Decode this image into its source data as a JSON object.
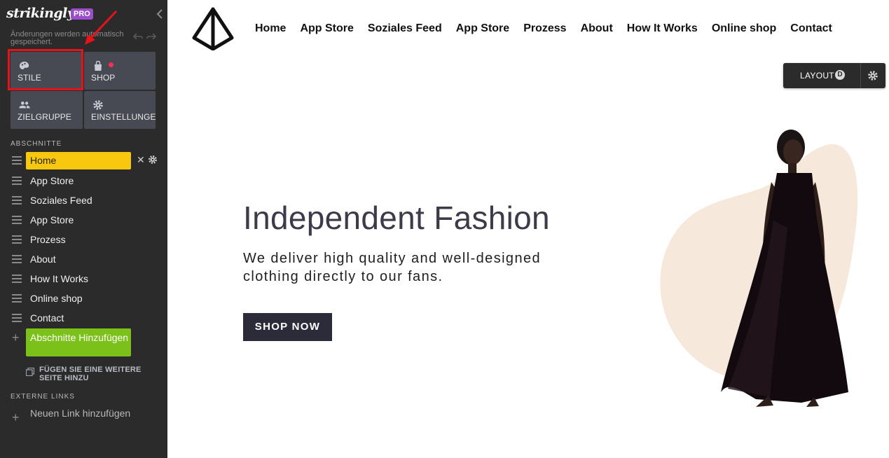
{
  "sidebar": {
    "logo": "strikingly",
    "badge": "PRO",
    "save_note": "Änderungen werden automatisch gespeichert.",
    "tiles": {
      "stile": "STILE",
      "shop": "SHOP",
      "zielgruppe": "ZIELGRUPPE",
      "einstellungen": "EINSTELLUNGEN"
    },
    "sections_heading": "ABSCHNITTE",
    "sections": [
      "Home",
      "App Store",
      "Soziales Feed",
      "App Store",
      "Prozess",
      "About",
      "How It Works",
      "Online shop",
      "Contact"
    ],
    "add_section": "Abschnitte Hinzufügen",
    "add_page": "FÜGEN SIE EINE WEITERE SEITE HINZU",
    "external_heading": "EXTERNE LINKS",
    "add_link": "Neuen Link hinzufügen"
  },
  "nav": {
    "items": [
      "Home",
      "App Store",
      "Soziales Feed",
      "App Store",
      "Prozess",
      "About",
      "How It Works",
      "Online shop",
      "Contact"
    ]
  },
  "layout_button": {
    "label": "LAYOUT",
    "badge": "D"
  },
  "hero": {
    "title": "Independent Fashion",
    "subtitle": "We deliver high quality and well-designed clothing directly to our fans.",
    "cta": "SHOP NOW"
  },
  "colors": {
    "sidebar_bg": "#2b2b2b",
    "tile_bg": "#474a53",
    "active_section": "#f8c80f",
    "add_button": "#7bc11a",
    "pro_badge": "#9b4dca",
    "highlight": "#e8121a",
    "cta_bg": "#2c2b3a",
    "blob": "#f6e9dc"
  },
  "icons": {
    "stile": "palette-icon",
    "shop": "shopping-bag-icon",
    "zielgruppe": "people-icon",
    "einstellungen": "gear-icon"
  }
}
